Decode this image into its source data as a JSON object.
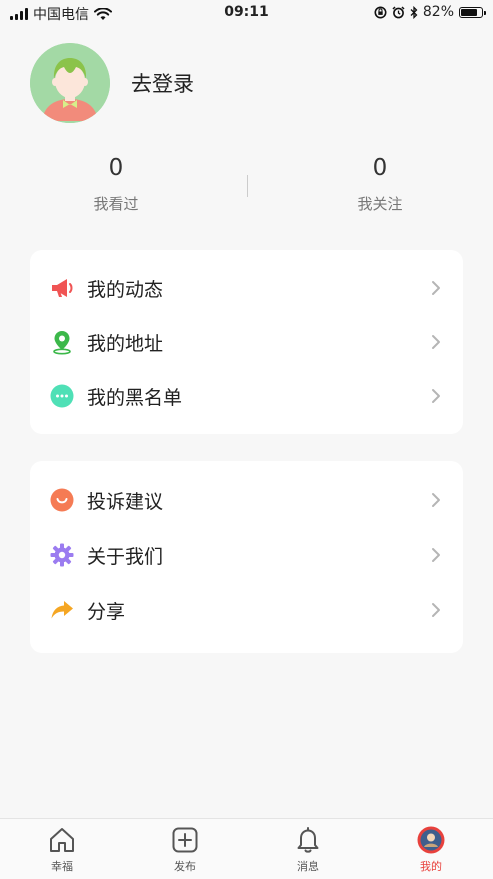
{
  "status_bar": {
    "carrier": "中国电信",
    "time": "09:11",
    "battery": "82%",
    "battery_level": 0.82
  },
  "profile": {
    "login_label": "去登录"
  },
  "stats": {
    "viewed": {
      "value": "0",
      "label": "我看过"
    },
    "following": {
      "value": "0",
      "label": "我关注"
    }
  },
  "menu_group_1": [
    {
      "label": "我的动态",
      "icon": "megaphone-icon",
      "color": "#f05454"
    },
    {
      "label": "我的地址",
      "icon": "location-pin-icon",
      "color": "#3cb84a"
    },
    {
      "label": "我的黑名单",
      "icon": "chat-bubble-icon",
      "color": "#4fe0b6"
    }
  ],
  "menu_group_2": [
    {
      "label": "投诉建议",
      "icon": "smile-icon",
      "color": "#f57b54"
    },
    {
      "label": "关于我们",
      "icon": "gear-icon",
      "color": "#9b7cf0"
    },
    {
      "label": "分享",
      "icon": "share-arrow-icon",
      "color": "#f5a623"
    }
  ],
  "tabs": [
    {
      "label": "幸福",
      "icon": "home-icon",
      "active": false
    },
    {
      "label": "发布",
      "icon": "plus-square-icon",
      "active": false
    },
    {
      "label": "消息",
      "icon": "bell-icon",
      "active": false
    },
    {
      "label": "我的",
      "icon": "profile-avatar-icon",
      "active": true
    }
  ],
  "colors": {
    "accent": "#e8413c",
    "background": "#f7f7f7",
    "card": "#ffffff"
  }
}
